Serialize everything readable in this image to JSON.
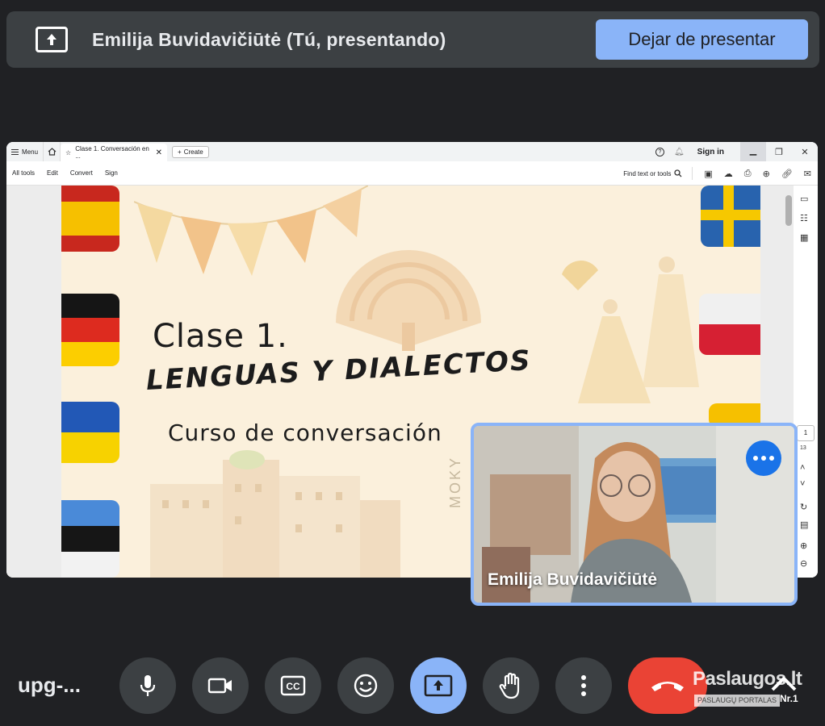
{
  "banner": {
    "title": "Emilija Buvidavičiūtė (Tú, presentando)",
    "stop_label": "Dejar de presentar"
  },
  "browser": {
    "menu_label": "Menu",
    "tab_title": "Clase 1. Conversación en ...",
    "create_label": "Create",
    "sign_in_label": "Sign in",
    "toolbar_items": [
      "All tools",
      "Edit",
      "Convert",
      "Sign"
    ],
    "find_label": "Find text or tools",
    "page_current": "1",
    "page_total": "13"
  },
  "slide": {
    "line1": "Clase 1.",
    "line2": "LENGUAS Y DIALECTOS",
    "line3": "Curso de conversación",
    "watermark": "MOKY"
  },
  "self_view": {
    "name": "Emilija Buvidavičiūtė"
  },
  "bottom": {
    "meeting_code": "upg-..."
  },
  "logo": {
    "name": "Paslaugos.lt",
    "subtitle": "PASLAUGŲ PORTALAS",
    "badge": "Nr.1"
  },
  "colors": {
    "background": "#202124",
    "banner": "#3c4043",
    "accent": "#8ab4f8",
    "control": "#3c4043",
    "end_call": "#ea4335",
    "more_button": "#1a73e8"
  }
}
